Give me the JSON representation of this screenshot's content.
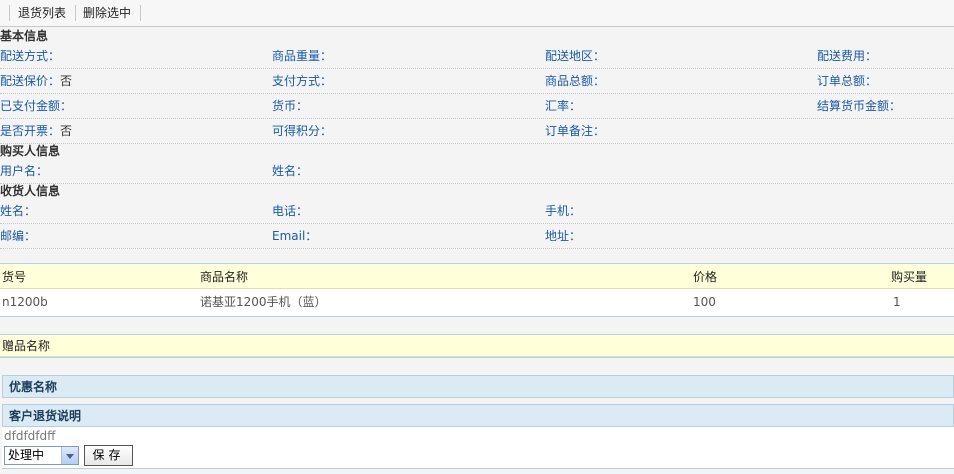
{
  "toolbar": {
    "return_list": "退货列表",
    "delete_selected": "删除选中"
  },
  "basic_info": {
    "title": "基本信息",
    "rows": [
      [
        {
          "label": "配送方式：",
          "value": ""
        },
        {
          "label": "商品重量：",
          "value": ""
        },
        {
          "label": "配送地区：",
          "value": ""
        },
        {
          "label": "配送费用：",
          "value": ""
        }
      ],
      [
        {
          "label": "配送保价：",
          "value": "否"
        },
        {
          "label": "支付方式：",
          "value": ""
        },
        {
          "label": "商品总额：",
          "value": ""
        },
        {
          "label": "订单总额：",
          "value": ""
        }
      ],
      [
        {
          "label": "已支付金额：",
          "value": ""
        },
        {
          "label": "货币：",
          "value": ""
        },
        {
          "label": "汇率：",
          "value": ""
        },
        {
          "label": "结算货币金额：",
          "value": ""
        }
      ],
      [
        {
          "label": "是否开票：",
          "value": "否"
        },
        {
          "label": "可得积分：",
          "value": ""
        },
        {
          "label": "订单备注：",
          "value": ""
        }
      ]
    ]
  },
  "buyer_info": {
    "title": "购买人信息",
    "fields": [
      {
        "label": "用户名：",
        "value": ""
      },
      {
        "label": "姓名：",
        "value": ""
      }
    ]
  },
  "receiver_info": {
    "title": "收货人信息",
    "rows": [
      [
        {
          "label": "姓名：",
          "value": ""
        },
        {
          "label": "电话：",
          "value": ""
        },
        {
          "label": "手机：",
          "value": ""
        }
      ],
      [
        {
          "label": "邮编：",
          "value": ""
        },
        {
          "label": "Email：",
          "value": ""
        },
        {
          "label": "地址：",
          "value": ""
        }
      ]
    ]
  },
  "products": {
    "headers": [
      "货号",
      "商品名称",
      "价格",
      "购买量"
    ],
    "rows": [
      [
        "n1200b",
        "诺基亚1200手机（蓝）",
        "100",
        "1"
      ]
    ]
  },
  "gifts": {
    "header": "赠品名称"
  },
  "promotion": {
    "title": "优惠名称"
  },
  "customer_note": {
    "title": "客户退货说明",
    "text": "dfdfdfdff"
  },
  "status_select": {
    "selected": "处理中"
  },
  "save_button": {
    "label": "保存"
  }
}
